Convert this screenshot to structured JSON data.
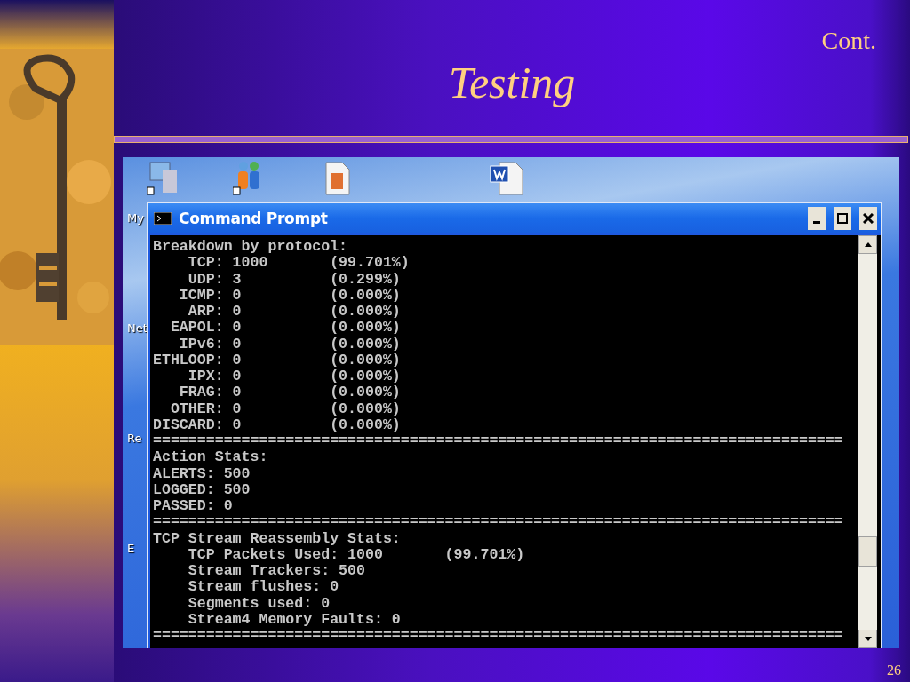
{
  "slide": {
    "subtitle": "Cont.",
    "title": "Testing",
    "page_number": "26"
  },
  "desktop": {
    "icon_labels": [
      "My",
      "Net",
      "Re",
      "E"
    ]
  },
  "window": {
    "title": "Command Prompt"
  },
  "console": {
    "lines": [
      "Breakdown by protocol:",
      "    TCP: 1000       (99.701%)",
      "    UDP: 3          (0.299%)",
      "   ICMP: 0          (0.000%)",
      "    ARP: 0          (0.000%)",
      "  EAPOL: 0          (0.000%)",
      "   IPv6: 0          (0.000%)",
      "ETHLOOP: 0          (0.000%)",
      "    IPX: 0          (0.000%)",
      "   FRAG: 0          (0.000%)",
      "  OTHER: 0          (0.000%)",
      "DISCARD: 0          (0.000%)",
      "==============================================================================",
      "Action Stats:",
      "ALERTS: 500",
      "LOGGED: 500",
      "PASSED: 0",
      "==============================================================================",
      "TCP Stream Reassembly Stats:",
      "    TCP Packets Used: 1000       (99.701%)",
      "    Stream Trackers: 500",
      "    Stream flushes: 0",
      "    Segments used: 0",
      "    Stream4 Memory Faults: 0",
      "=============================================================================="
    ]
  }
}
